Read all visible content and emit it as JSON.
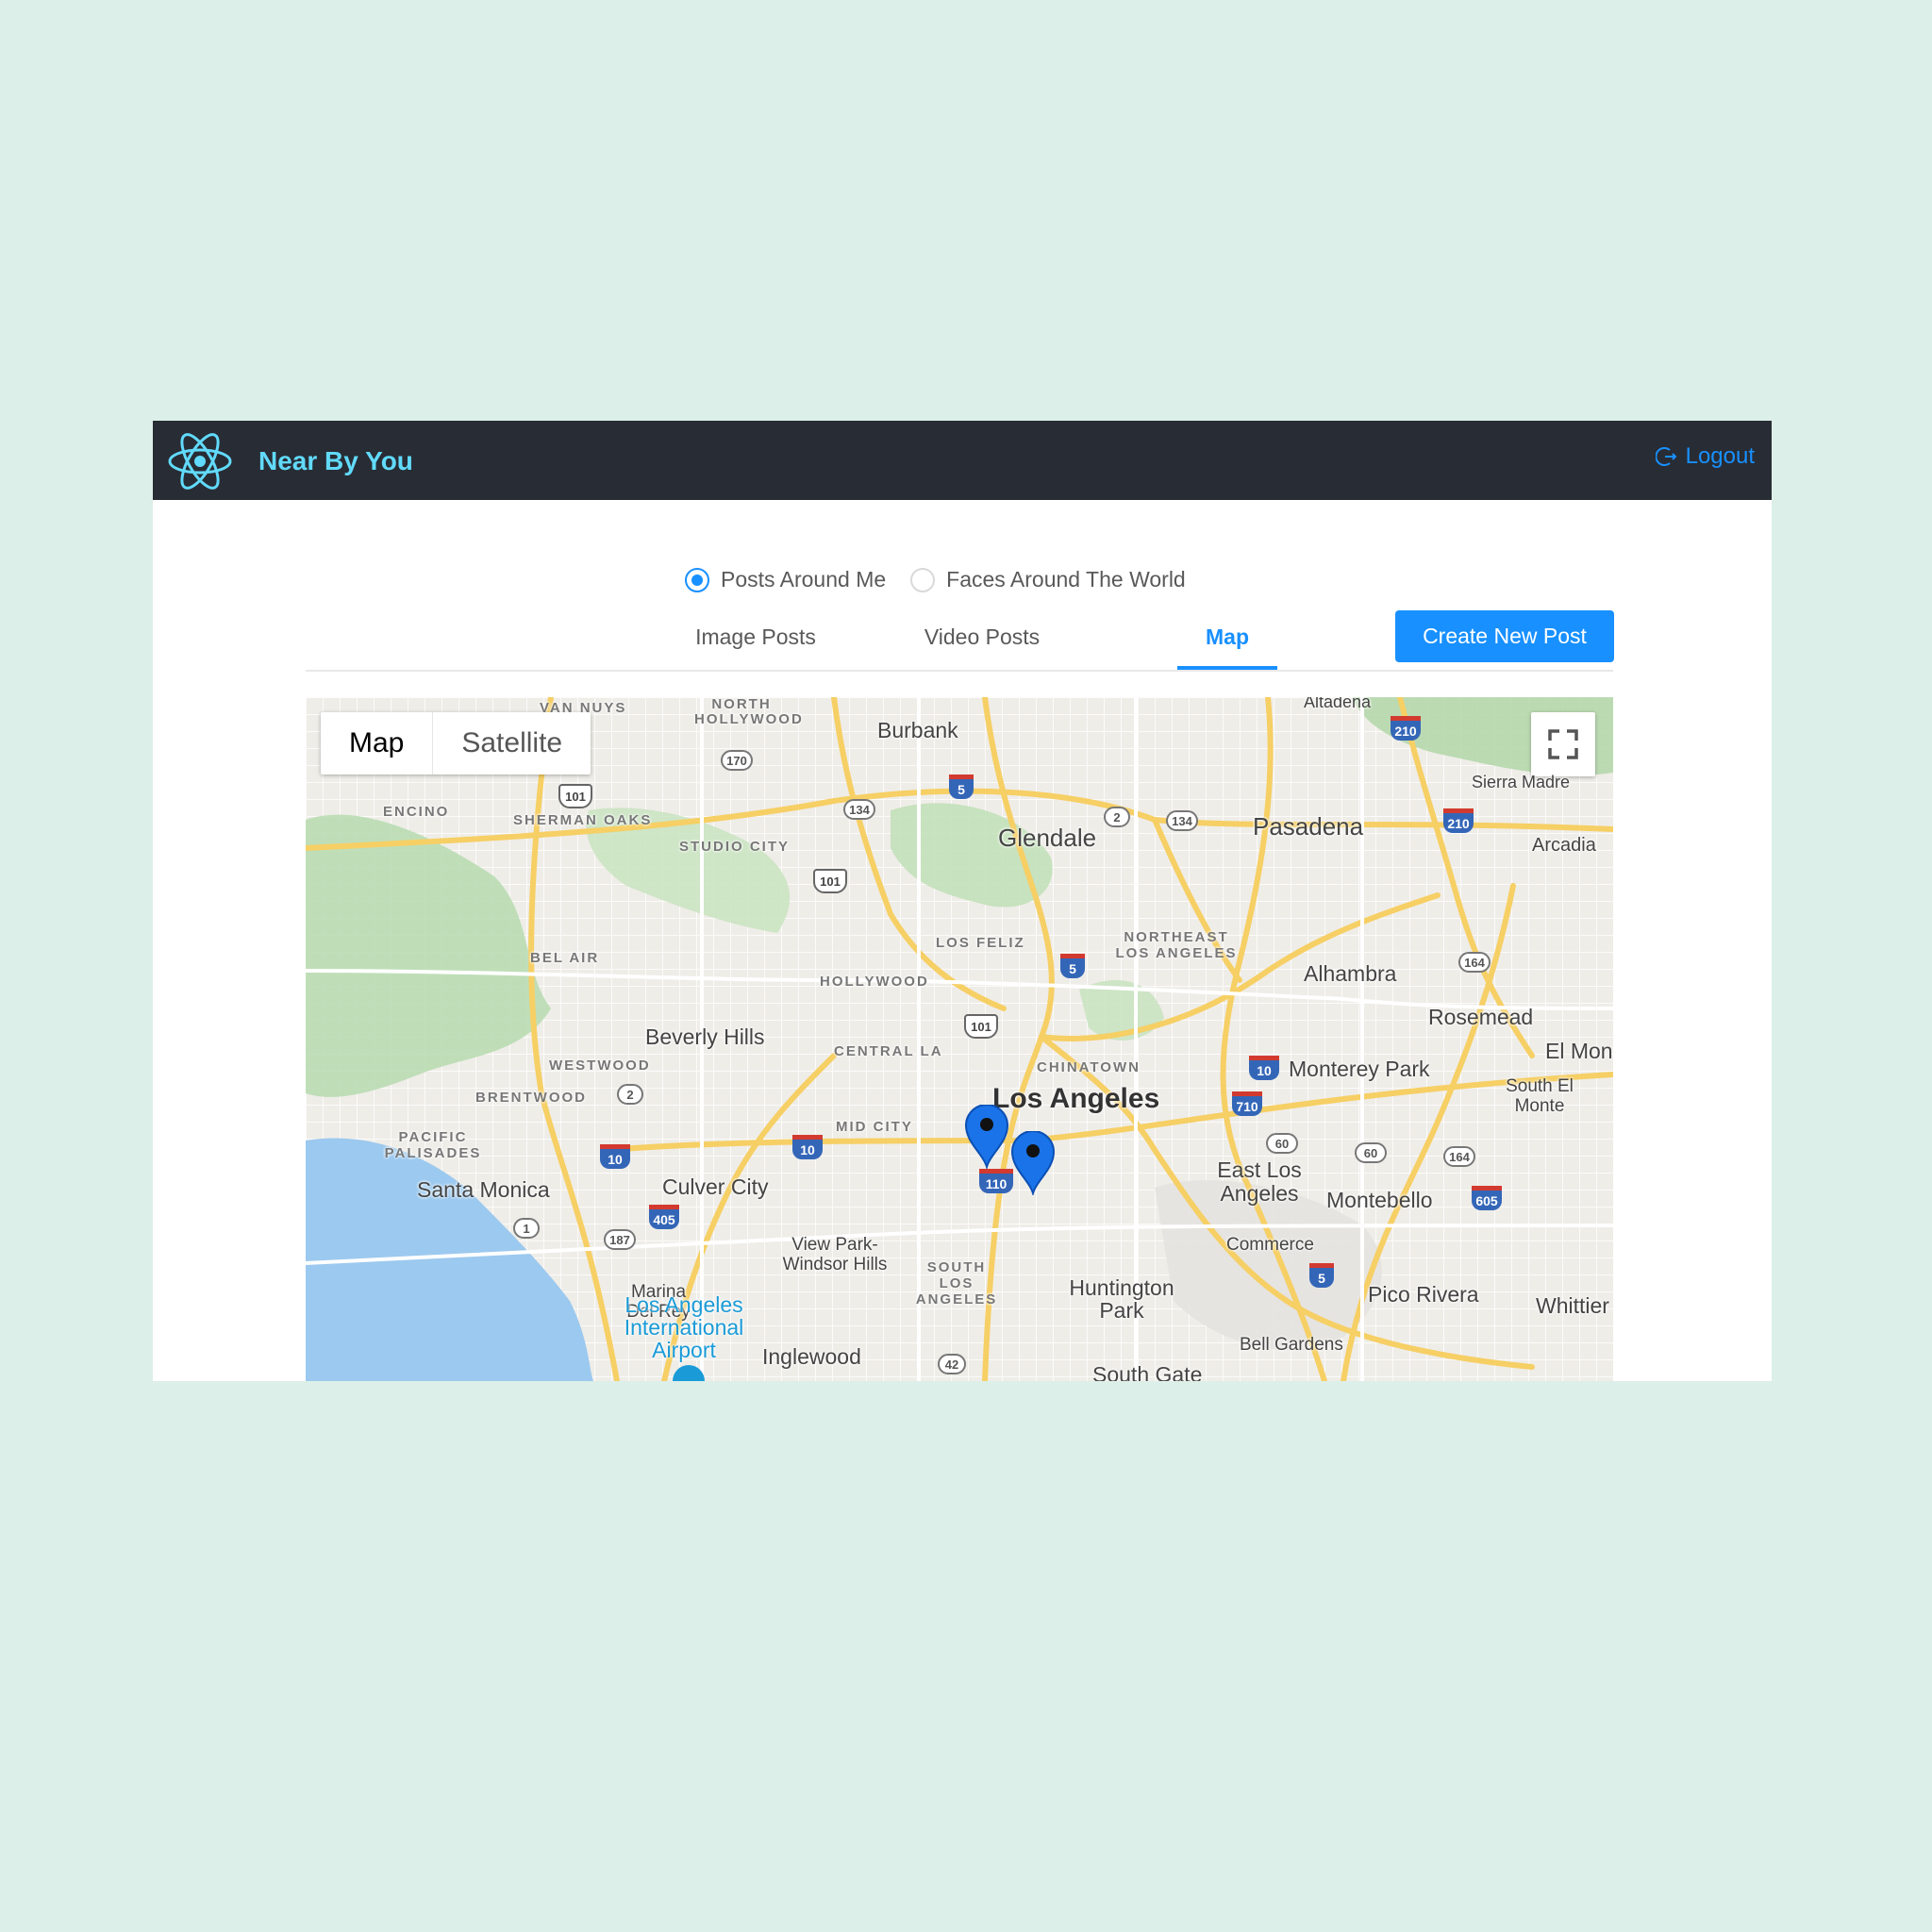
{
  "header": {
    "title": "Near By You",
    "logout_label": "Logout"
  },
  "radio": {
    "options": [
      "Posts Around Me",
      "Faces Around The World"
    ],
    "selected": "Posts Around Me"
  },
  "tabs": [
    {
      "label": "Image Posts",
      "active": false
    },
    {
      "label": "Video Posts",
      "active": false
    },
    {
      "label": "Map",
      "active": true
    }
  ],
  "create_button": "Create New Post",
  "map": {
    "type_controls": [
      "Map",
      "Satellite"
    ],
    "selected_type": "Map",
    "labels": {
      "la": "Los Angeles",
      "burbank": "Burbank",
      "glendale": "Glendale",
      "pasadena": "Pasadena",
      "altadena": "Altadena",
      "sierra_madre": "Sierra Madre",
      "arcadia": "Arcadia",
      "alhambra": "Alhambra",
      "rosemead": "Rosemead",
      "el_monte": "El Mon",
      "monterey_park": "Monterey Park",
      "south_el_monte": "South El Monte",
      "beverly_hills": "Beverly Hills",
      "santa_monica": "Santa Monica",
      "culver_city": "Culver City",
      "east_la": "East Los Angeles",
      "montebello": "Montebello",
      "commerce": "Commerce",
      "pico_rivera": "Pico Rivera",
      "whittier": "Whittier",
      "huntington_park": "Huntington Park",
      "bell_gardens": "Bell Gardens",
      "south_gate": "South Gate",
      "inglewood": "Inglewood",
      "view_park": "View Park-Windsor Hills",
      "marina": "Marina Del Rey",
      "lax": "Los Angeles International Airport",
      "van_nuys": "VAN NUYS",
      "north_hollywood": "NORTH HOLLYWOOD",
      "encino": "ENCINO",
      "sherman_oaks": "SHERMAN OAKS",
      "studio_city": "STUDIO CITY",
      "bel_air": "BEL AIR",
      "hollywood": "HOLLYWOOD",
      "los_feliz": "LOS FELIZ",
      "northeast_la": "NORTHEAST LOS ANGELES",
      "central_la": "CENTRAL LA",
      "westwood": "WESTWOOD",
      "brentwood": "BRENTWOOD",
      "pacific_palisades": "PACIFIC PALISADES",
      "mid_city": "MID CITY",
      "chinatown": "CHINATOWN",
      "south_la": "SOUTH LOS ANGELES"
    },
    "shields": [
      "210",
      "170",
      "101",
      "5",
      "134",
      "2",
      "134",
      "210",
      "101",
      "5",
      "164",
      "101",
      "10",
      "2",
      "710",
      "60",
      "10",
      "10",
      "110",
      "60",
      "164",
      "405",
      "187",
      "1",
      "605",
      "5",
      "42"
    ],
    "marker_count": 2
  },
  "colors": {
    "header_bg": "#282c34",
    "brand": "#61dafb",
    "primary": "#1890ff",
    "page_bg": "#dcefe8"
  },
  "icons": {
    "logo": "react-atom-icon",
    "logout": "logout-icon",
    "fullscreen": "fullscreen-icon",
    "marker": "map-pin-icon"
  }
}
